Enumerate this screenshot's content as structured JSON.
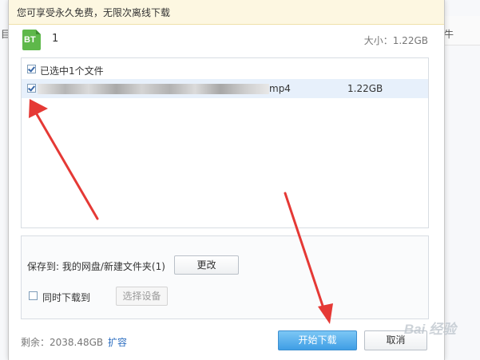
{
  "background": {
    "left_fragment": "目",
    "right_fragment": "牛"
  },
  "dialog": {
    "notice": "您可享受永久免费，无限次离线下载",
    "torrent": {
      "icon_label": "BT",
      "name": "1",
      "total_size": "大小：1.22GB"
    },
    "file_list": {
      "select_all_label": "已选中1个文件",
      "files": [
        {
          "ext": "mp4",
          "size": "1.22GB",
          "checked": true
        }
      ]
    },
    "save": {
      "label": "保存到: 我的网盘/新建文件夹(1)",
      "change_button": "更改",
      "also_download_label": "同时下载到",
      "select_device_button": "选择设备"
    },
    "footer": {
      "space": "剩余：2038.48GB",
      "expand": "扩容",
      "start_button": "开始下载",
      "cancel_button": "取消"
    }
  },
  "watermark": "Bai 经验",
  "colors": {
    "notice_bg": "#fdf7e1",
    "bt_green": "#5eb84a",
    "link_blue": "#2e6fc1",
    "primary_button": "#3f9ee5",
    "arrow_red": "#e53935"
  },
  "icons": [
    "bt-file-icon",
    "checkbox-icon",
    "red-arrow-annotation"
  ]
}
